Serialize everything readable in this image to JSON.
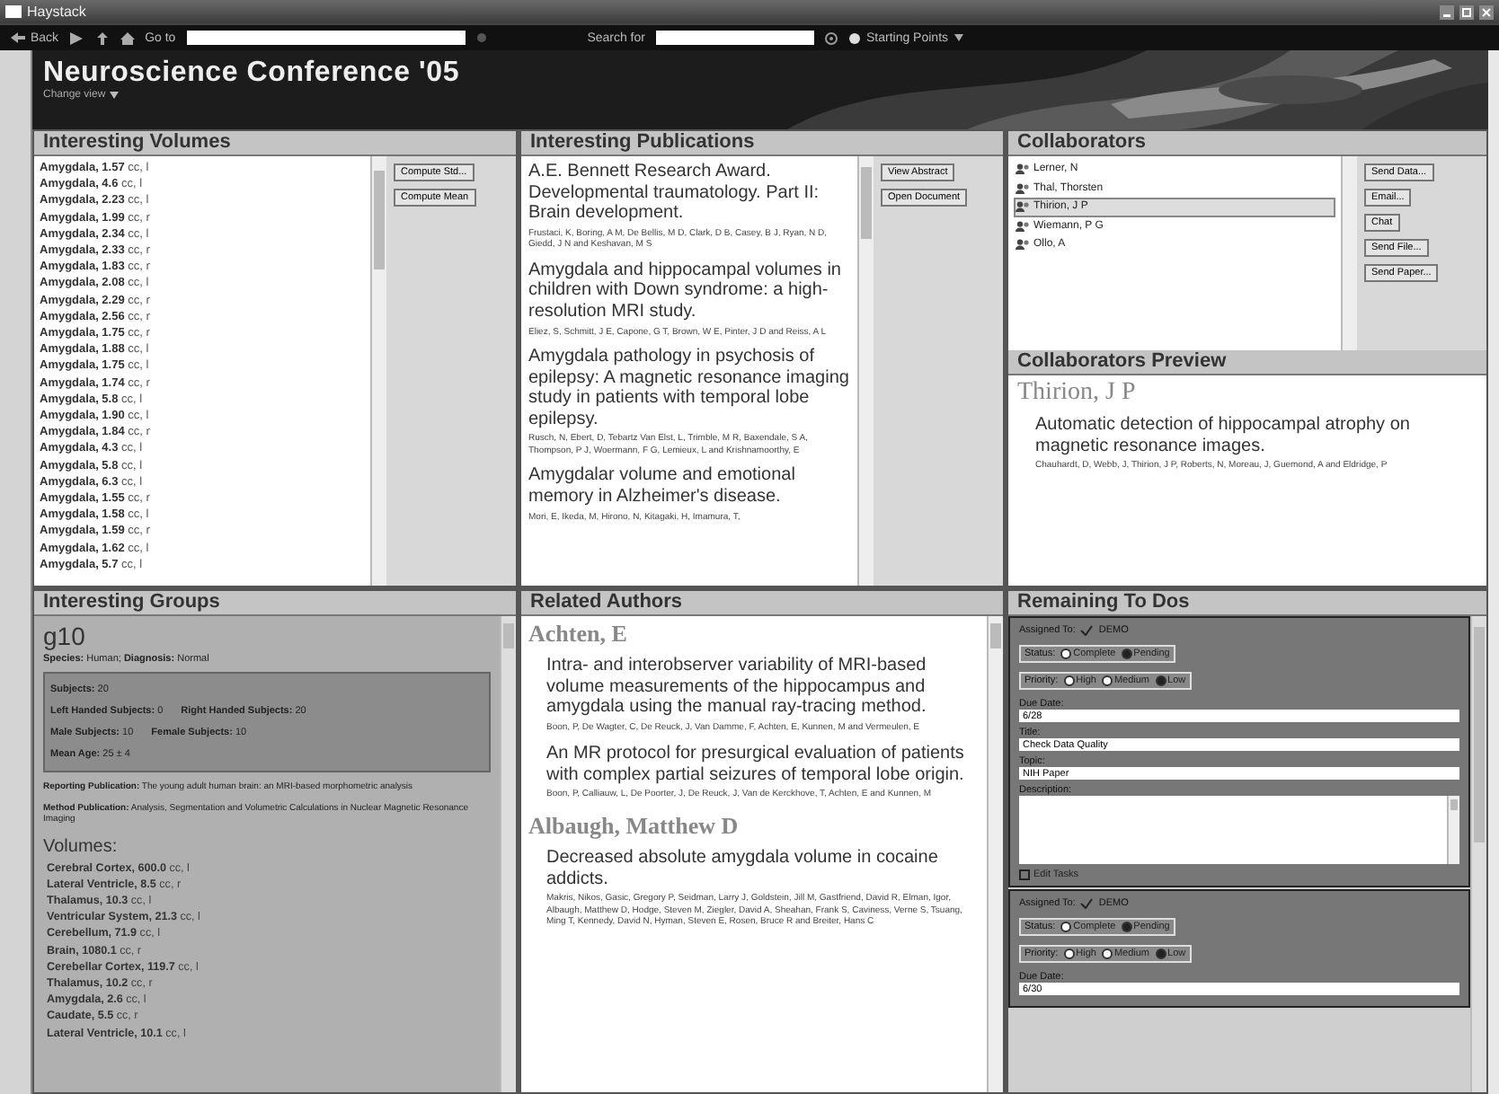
{
  "window": {
    "title": "Haystack"
  },
  "toolbar": {
    "back": "Back",
    "go_to": "Go to",
    "search_for": "Search for",
    "starting_points": "Starting Points"
  },
  "header": {
    "title": "Neuroscience Conference '05",
    "change_view": "Change view"
  },
  "volumes": {
    "title": "Interesting Volumes",
    "buttons": [
      "Compute Std...",
      "Compute Mean"
    ],
    "items": [
      {
        "name": "Amygdala,",
        "value": "1.57",
        "unit": "cc, l"
      },
      {
        "name": "Amygdala,",
        "value": "4.6",
        "unit": "cc, l"
      },
      {
        "name": "Amygdala,",
        "value": "2.23",
        "unit": "cc, l"
      },
      {
        "name": "Amygdala,",
        "value": "1.99",
        "unit": "cc, r"
      },
      {
        "name": "Amygdala,",
        "value": "2.34",
        "unit": "cc, l"
      },
      {
        "name": "Amygdala,",
        "value": "2.33",
        "unit": "cc, r"
      },
      {
        "name": "Amygdala,",
        "value": "1.83",
        "unit": "cc, r"
      },
      {
        "name": "Amygdala,",
        "value": "2.08",
        "unit": "cc, l"
      },
      {
        "name": "Amygdala,",
        "value": "2.29",
        "unit": "cc, r"
      },
      {
        "name": "Amygdala,",
        "value": "2.56",
        "unit": "cc, r"
      },
      {
        "name": "Amygdala,",
        "value": "1.75",
        "unit": "cc, r"
      },
      {
        "name": "Amygdala,",
        "value": "1.88",
        "unit": "cc, l"
      },
      {
        "name": "Amygdala,",
        "value": "1.75",
        "unit": "cc, l"
      },
      {
        "name": "Amygdala,",
        "value": "1.74",
        "unit": "cc, r"
      },
      {
        "name": "Amygdala,",
        "value": "5.8",
        "unit": "cc, l"
      },
      {
        "name": "Amygdala,",
        "value": "1.90",
        "unit": "cc, l"
      },
      {
        "name": "Amygdala,",
        "value": "1.84",
        "unit": "cc, r"
      },
      {
        "name": "Amygdala,",
        "value": "4.3",
        "unit": "cc, l"
      },
      {
        "name": "Amygdala,",
        "value": "5.8",
        "unit": "cc, l"
      },
      {
        "name": "Amygdala,",
        "value": "6.3",
        "unit": "cc, l"
      },
      {
        "name": "Amygdala,",
        "value": "1.55",
        "unit": "cc, r"
      },
      {
        "name": "Amygdala,",
        "value": "1.58",
        "unit": "cc, l"
      },
      {
        "name": "Amygdala,",
        "value": "1.59",
        "unit": "cc, r"
      },
      {
        "name": "Amygdala,",
        "value": "1.62",
        "unit": "cc, l"
      },
      {
        "name": "Amygdala,",
        "value": "5.7",
        "unit": "cc, l"
      }
    ]
  },
  "publications": {
    "title": "Interesting Publications",
    "buttons": [
      "View Abstract",
      "Open Document"
    ],
    "items": [
      {
        "title": "A.E. Bennett Research Award. Developmental traumatology. Part II: Brain development.",
        "authors": "Frustaci, K, Boring, A M, De Bellis, M D, Clark, D B, Casey, B J, Ryan, N D, Giedd, J N and Keshavan, M S"
      },
      {
        "title": "Amygdala and hippocampal volumes in children with Down syndrome: a high-resolution MRI study.",
        "authors": "Eliez, S, Schmitt, J E, Capone, G T, Brown, W E, Pinter, J D and Reiss, A L"
      },
      {
        "title": "Amygdala pathology in psychosis of epilepsy: A magnetic resonance imaging study in patients with temporal lobe epilepsy.",
        "authors": "Rusch, N, Ebert, D, Tebartz Van Elst, L, Trimble, M R, Baxendale, S A, Thompson, P J, Woermann, F G, Lemieux, L and Krishnamoorthy, E"
      },
      {
        "title": "Amygdalar volume and emotional memory in Alzheimer's disease.",
        "authors": "Mori, E, Ikeda, M, Hirono, N, Kitagaki, H, Imamura, T,"
      }
    ]
  },
  "collaborators": {
    "title": "Collaborators",
    "buttons": [
      "Send Data...",
      "Email...",
      "Chat",
      "Send File...",
      "Send Paper..."
    ],
    "items": [
      {
        "name": "Lerner, N",
        "selected": false
      },
      {
        "name": "Thal, Thorsten",
        "selected": false
      },
      {
        "name": "Thirion, J P",
        "selected": true
      },
      {
        "name": "Wiemann, P G",
        "selected": false
      },
      {
        "name": "Ollo, A",
        "selected": false
      }
    ]
  },
  "preview": {
    "title": "Collaborators Preview",
    "name": "Thirion, J P",
    "publication": "Automatic detection of hippocampal atrophy on magnetic resonance images.",
    "authors": "Chauhardt, D, Webb, J, Thirion, J P, Roberts, N, Moreau, J, Guemond, A and Eldridge, P"
  },
  "groups": {
    "title": "Interesting Groups",
    "name": "g10",
    "species_label": "Species:",
    "species": "Human;",
    "diagnosis_label": "Diagnosis:",
    "diagnosis": "Normal",
    "stats": [
      [
        {
          "label": "Subjects:",
          "value": "20"
        }
      ],
      [
        {
          "label": "Left Handed Subjects:",
          "value": "0"
        },
        {
          "label": "Right Handed Subjects:",
          "value": "20"
        }
      ],
      [
        {
          "label": "Male Subjects:",
          "value": "10"
        },
        {
          "label": "Female Subjects:",
          "value": "10"
        }
      ],
      [
        {
          "label": "Mean Age:",
          "value": "25 ± 4"
        }
      ]
    ],
    "reporting": "**Reporting Publication:** The young adult human brain: an MRI-based morphometric analysis",
    "method": "**Method Publication:** Analysis, Segmentation and Volumetric Calculations in Nuclear Magnetic Resonance Imaging",
    "volumes_label": "Volumes:",
    "volumes": [
      {
        "name": "Cerebral Cortex,",
        "value": "600.0",
        "unit": "cc, l"
      },
      {
        "name": "Lateral Ventricle,",
        "value": "8.5",
        "unit": "cc, r"
      },
      {
        "name": "Thalamus,",
        "value": "10.3",
        "unit": "cc, l"
      },
      {
        "name": "Ventricular System,",
        "value": "21.3",
        "unit": "cc, l"
      },
      {
        "name": "Cerebellum,",
        "value": "71.9",
        "unit": "cc, l"
      },
      {
        "name": "Brain,",
        "value": "1080.1",
        "unit": "cc, r"
      },
      {
        "name": "Cerebellar Cortex,",
        "value": "119.7",
        "unit": "cc, l"
      },
      {
        "name": "Thalamus,",
        "value": "10.2",
        "unit": "cc, r"
      },
      {
        "name": "Amygdala,",
        "value": "2.6",
        "unit": "cc, l"
      },
      {
        "name": "Caudate,",
        "value": "5.5",
        "unit": "cc, r"
      },
      {
        "name": "Lateral Ventricle,",
        "value": "10.1",
        "unit": "cc, l"
      }
    ]
  },
  "related": {
    "title": "Related Authors",
    "authors": [
      {
        "name": "Achten, E",
        "publications": [
          {
            "title": "Intra- and interobserver variability of MRI-based volume measurements of the hippocampus and amygdala using the manual ray-tracing method.",
            "authors": "Boon, P, De Wagter, C, De Reuck, J, Van Damme, F, Achten, E, Kunnen, M and Vermeulen, E"
          },
          {
            "title": "An MR protocol for presurgical evaluation of patients with complex partial seizures of temporal lobe origin.",
            "authors": "Boon, P, Calliauw, L, De Poorter, J, De Reuck, J, Van de Kerckhove, T, Achten, E and Kunnen, M"
          }
        ]
      },
      {
        "name": "Albaugh, Matthew D",
        "publications": [
          {
            "title": "Decreased absolute amygdala volume in cocaine addicts.",
            "authors": "Makris, Nikos, Gasic, Gregory P, Seidman, Larry J, Goldstein, Jill M, Gastfriend, David R, Elman, Igor, Albaugh, Matthew D, Hodge, Steven M, Ziegler, David A, Sheahan, Frank S, Caviness, Verne S, Tsuang, Ming T, Kennedy, David N, Hyman, Steven E, Rosen, Bruce R and Breiter, Hans C"
          }
        ]
      }
    ]
  },
  "todos": {
    "title": "Remaining To Dos",
    "items": [
      {
        "assigned_label": "Assigned To:",
        "assigned": "DEMO",
        "status_label": "Status:",
        "status": [
          {
            "label": "Complete",
            "selected": false
          },
          {
            "label": "Pending",
            "selected": true
          }
        ],
        "priority_label": "Priority:",
        "priority": [
          {
            "label": "High",
            "selected": false
          },
          {
            "label": "Medium",
            "selected": false
          },
          {
            "label": "Low",
            "selected": true
          }
        ],
        "fields": [
          {
            "label": "Due Date:",
            "value": "6/28",
            "kind": "line"
          },
          {
            "label": "Title:",
            "value": "Check Data Quality",
            "kind": "line"
          },
          {
            "label": "Topic:",
            "value": "NIH Paper",
            "kind": "line"
          },
          {
            "label": "Description:",
            "kind": "area"
          }
        ],
        "edit_label": "Edit Tasks",
        "edit_checked": false
      },
      {
        "assigned_label": "Assigned To:",
        "assigned": "DEMO",
        "status_label": "Status:",
        "status": [
          {
            "label": "Complete",
            "selected": false
          },
          {
            "label": "Pending",
            "selected": true
          }
        ],
        "priority_label": "Priority:",
        "priority": [
          {
            "label": "High",
            "selected": false
          },
          {
            "label": "Medium",
            "selected": false
          },
          {
            "label": "Low",
            "selected": true
          }
        ],
        "fields": [
          {
            "label": "Due Date:",
            "value": "6/30",
            "kind": "line"
          }
        ]
      }
    ]
  }
}
